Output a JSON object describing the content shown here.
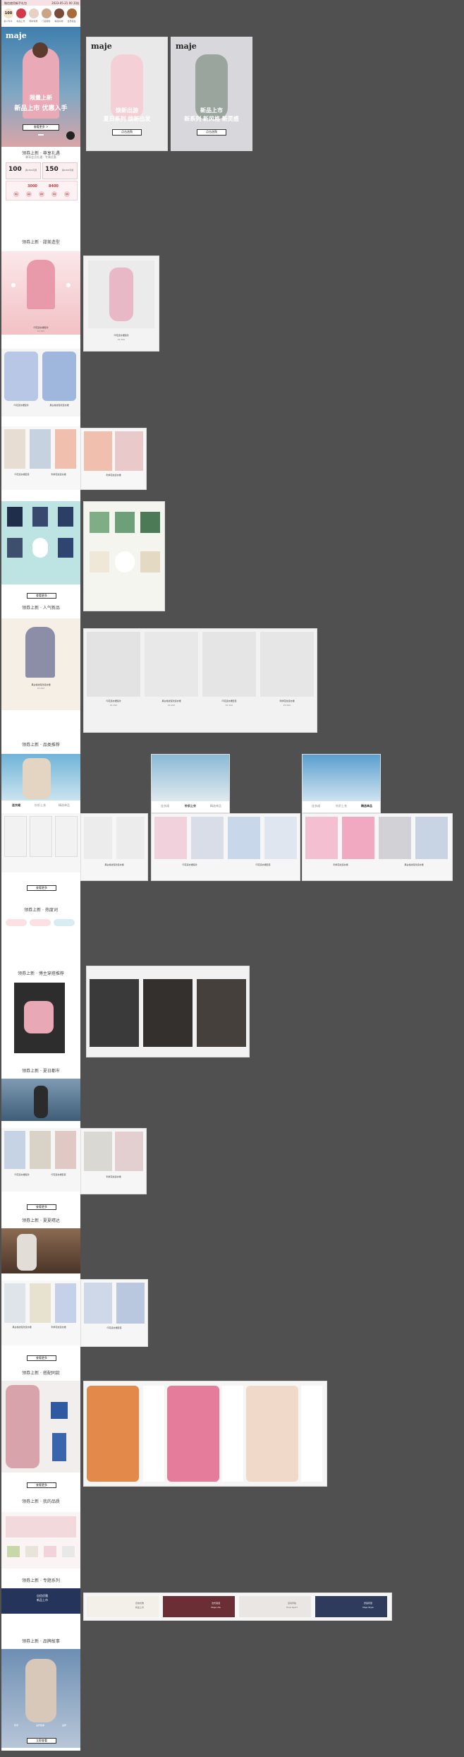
{
  "top_bar": {
    "text": "微信使用新手礼包",
    "right_text": "2023-05-21 00 开抢"
  },
  "coupon_strip": [
    "100",
    "10",
    "20",
    "30",
    "40",
    "50"
  ],
  "nav_icons": [
    "新人专享",
    "新品上市",
    "限时特惠",
    "门店服务",
    "精选好物",
    "会员权益"
  ],
  "hero": {
    "logo": "maje",
    "title": "限量上新",
    "subtitle": "新品上市 优惠入手",
    "button": "查看更多 >",
    "slide2_title": "焕新出游",
    "slide2_subtitle": "夏日系列 焕新出发",
    "slide2_button": "点击选购",
    "slide3_title": "新品上市",
    "slide3_subtitle": "新系列 新风格 新灵感",
    "slide3_button": "点击选购"
  },
  "coupon_section": {
    "title": "领券上新 · 尊享礼遇",
    "subtitle": "尊享会员礼遇 ‧ 专属优惠",
    "coupons": [
      {
        "value": "100",
        "desc": "满1500可用"
      },
      {
        "value": "150",
        "desc": "满2000可用"
      }
    ],
    "gift": {
      "a": "3000",
      "b": "8400"
    },
    "badges": [
      "01",
      "02",
      "03",
      "04",
      "05"
    ]
  },
  "sections": {
    "s1": "领券上新 · 甜美造型",
    "s2": "领券上新 · 人气新品",
    "s3": "领券上新 · 品类推荐",
    "s4": "领券上新 · 热度词",
    "s5": "领券上新 · 博主穿搭推荐",
    "s6": "领券上新 · 夏日都市",
    "s7": "领券上新 · 夏夏晴达",
    "s8": "领券上新 · 搭配同款",
    "s9": "领券上新 · 我的品质",
    "s10": "领券上新 · 专题系列",
    "s11": "领券上新 · 品牌故事"
  },
  "product": {
    "name": "印花连衣裙短款",
    "price": "¥2,390"
  },
  "products_row": [
    {
      "name": "印花连衣裙短款",
      "price": "¥2,390"
    },
    {
      "name": "黑白格纹短款连衣裙",
      "price": "¥2,490"
    },
    {
      "name": "印花连衣裙套装",
      "price": "¥2,190"
    },
    {
      "name": "刺绣花纹连衣裙",
      "price": "¥2,690"
    }
  ],
  "tabs": {
    "a": "连衣裙",
    "b": "针织上衣",
    "c": "精选单品"
  },
  "view_more": "查看更多",
  "brand_story": {
    "button": "立即查看",
    "tags": [
      "搜索",
      "品牌故事",
      "品牌"
    ]
  },
  "promo_banners": [
    {
      "line1": "自信优雅",
      "line2": "新品上市"
    },
    {
      "line1": "法式浪漫",
      "line2": "Maje Life"
    },
    {
      "line1": "运动风格",
      "line2": "Pure Sport"
    },
    {
      "line1": "舒适有型",
      "line2": "Maje Style"
    }
  ],
  "colors": {
    "hero_bg": "#3c7fb0",
    "pink": "#f4c7cd",
    "teal": "#8dd1d1",
    "dark_bg": "#505050"
  }
}
